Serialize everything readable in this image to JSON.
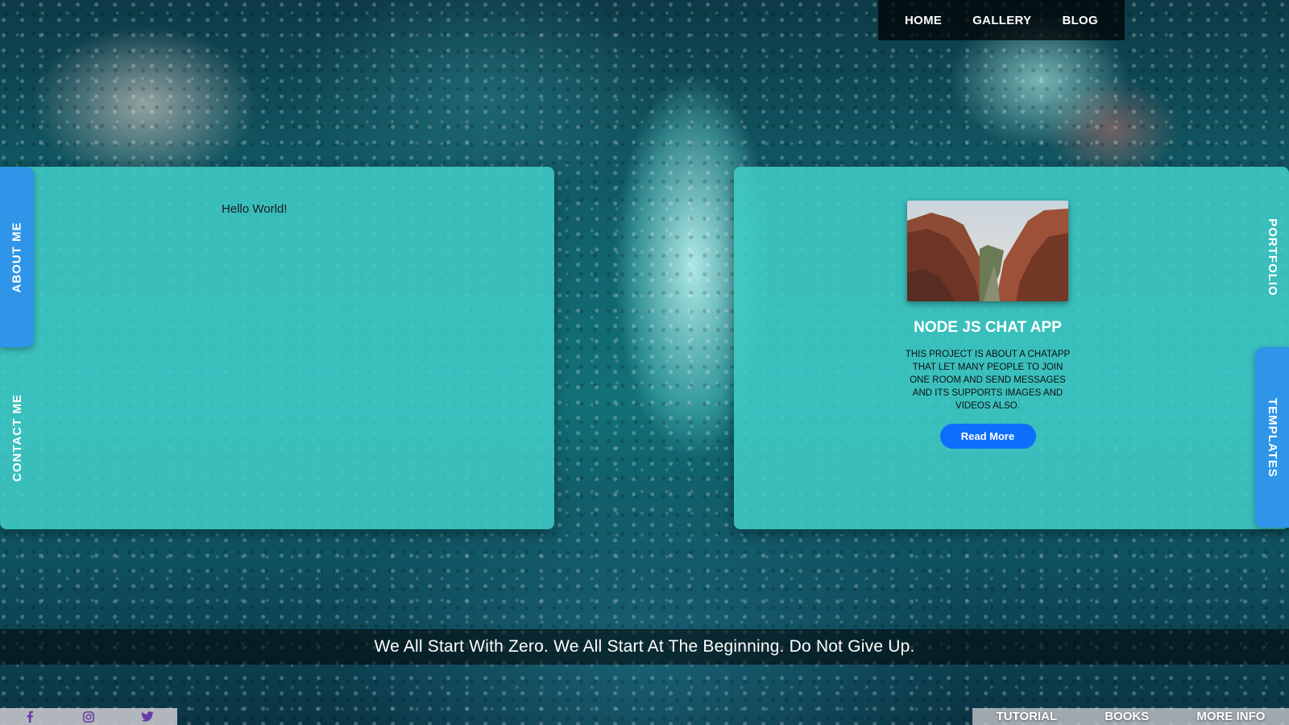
{
  "nav": {
    "items": [
      "HOME",
      "GALLERY",
      "BLOG"
    ]
  },
  "about_panel": {
    "greeting": "Hello World!",
    "tab_about": "ABOUT ME",
    "tab_contact": "CONTACT ME"
  },
  "portfolio_panel": {
    "tab_portfolio": "PORTFOLIO",
    "tab_templates": "TEMPLATES",
    "card": {
      "image_icon": "canyon-landscape-image",
      "title": "NODE JS CHAT APP",
      "description": "THIS PROJECT IS ABOUT A CHATAPP THAT LET MANY PEOPLE TO JOIN ONE ROOM AND SEND MESSAGES AND ITS SUPPORTS IMAGES AND VIDEOS ALSO.",
      "button": "Read More"
    }
  },
  "quote": "We All Start With Zero. We All Start At The Beginning. Do Not Give Up.",
  "social": {
    "icons": [
      "facebook-icon",
      "instagram-icon",
      "twitter-icon"
    ],
    "icon_color": "#6a3aa8"
  },
  "footer_links": [
    "TUTORIAL",
    "BOOKS",
    "MORE INFO"
  ],
  "colors": {
    "panel": "#40cdc8",
    "tab": "#2f95e8",
    "button": "#0d6efd"
  }
}
